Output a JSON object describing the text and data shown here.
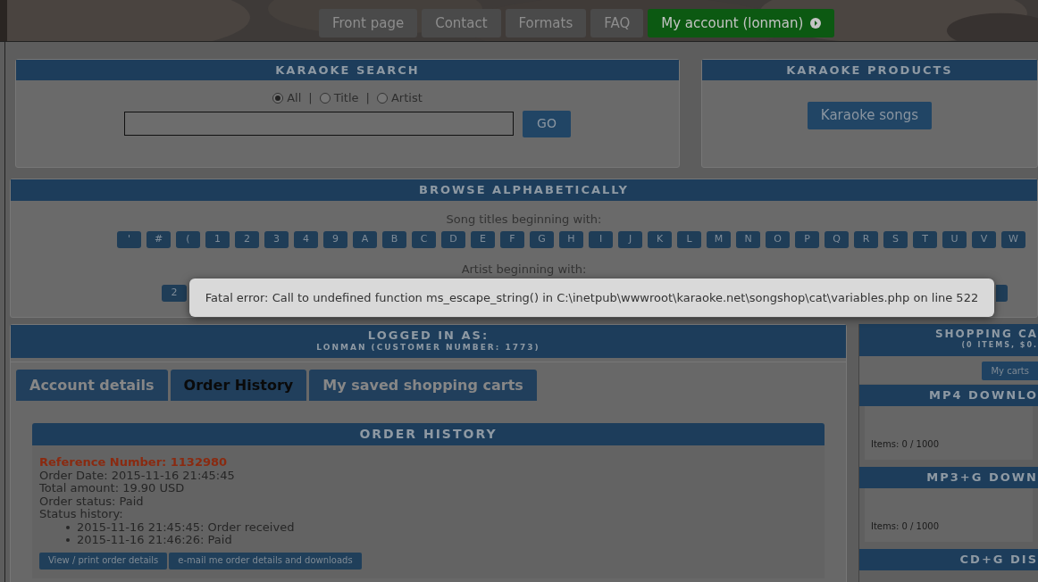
{
  "nav": [
    {
      "label": "Front page",
      "selected": false
    },
    {
      "label": "Contact",
      "selected": false
    },
    {
      "label": "Formats",
      "selected": false
    },
    {
      "label": "FAQ",
      "selected": false
    },
    {
      "label": "My account (lonman)",
      "selected": true
    }
  ],
  "search": {
    "title": "KARAOKE SEARCH",
    "options": [
      {
        "label": "All",
        "selected": true
      },
      {
        "label": "Title",
        "selected": false
      },
      {
        "label": "Artist",
        "selected": false
      }
    ],
    "separator": "|",
    "button": "GO"
  },
  "products": {
    "title": "KARAOKE PRODUCTS",
    "button": "Karaoke songs"
  },
  "browse": {
    "title": "BROWSE ALPHABETICALLY",
    "titles_label": "Song titles beginning with:",
    "title_letters": [
      "'",
      "#",
      "(",
      "1",
      "2",
      "3",
      "4",
      "9",
      "A",
      "B",
      "C",
      "D",
      "E",
      "F",
      "G",
      "H",
      "I",
      "J",
      "K",
      "L",
      "M",
      "N",
      "O",
      "P",
      "Q",
      "R",
      "S",
      "T",
      "U",
      "V",
      "W"
    ],
    "artist_label": "Artist beginning with:",
    "artist_first": "2"
  },
  "error": "Fatal error: Call to undefined function ms_escape_string() in C:\\inetpub\\wwwroot\\karaoke.net\\songshop\\cat\\variables.php on line 522",
  "account": {
    "title": "LOGGED IN AS:",
    "subtitle": "LONMAN (CUSTOMER NUMBER: 1773)",
    "tabs": [
      {
        "label": "Account details",
        "selected": false
      },
      {
        "label": "Order History",
        "selected": true
      },
      {
        "label": "My saved shopping carts",
        "selected": false
      }
    ],
    "order_history": {
      "title": "ORDER HISTORY",
      "orders": [
        {
          "reference": "Reference Number: 1132980",
          "lines": [
            "Order Date: 2015-11-16 21:45:45",
            "Total amount: 19.90 USD",
            "Order status: Paid",
            "Status history:"
          ],
          "history": [
            "2015-11-16 21:45:45: Order received",
            "2015-11-16 21:46:26: Paid"
          ],
          "buttons": [
            "View / print order details",
            "e-mail me order details and downloads"
          ]
        }
      ]
    }
  },
  "cart": {
    "title": "SHOPPING CA",
    "subtitle": "(0 ITEMS, $0.",
    "button": "My carts",
    "sections": [
      {
        "title": "MP4 DOWNLO",
        "items": "Items: 0 / 1000"
      },
      {
        "title": "MP3+G DOWN",
        "items": "Items: 0 / 1000"
      },
      {
        "title": "CD+G DIS"
      }
    ]
  }
}
